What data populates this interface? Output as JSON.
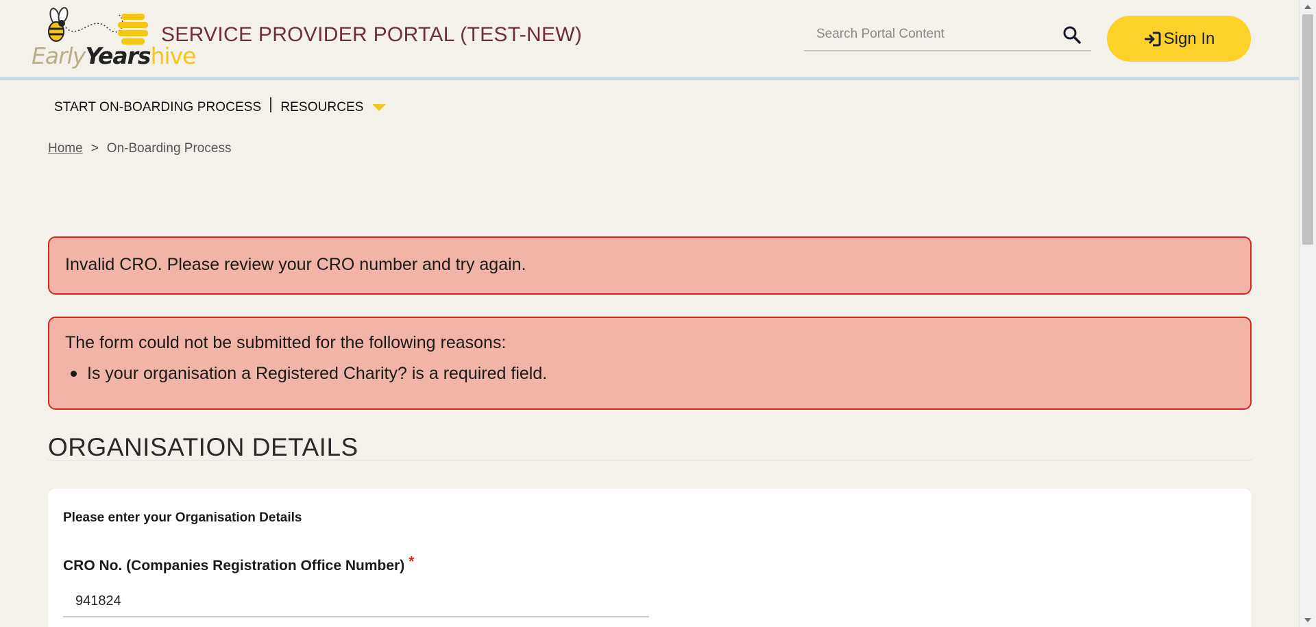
{
  "header": {
    "logo": {
      "early": "Early",
      "years": "Years",
      "hive": "hive"
    },
    "portal_title": "SERVICE PROVIDER PORTAL (TEST-NEW)",
    "search_placeholder": "Search Portal Content",
    "signin_label": "Sign In"
  },
  "nav": {
    "items": [
      {
        "label": "START ON-BOARDING PROCESS"
      },
      {
        "label": "RESOURCES"
      }
    ]
  },
  "breadcrumb": {
    "home": "Home",
    "separator": ">",
    "current": "On-Boarding Process"
  },
  "alerts": {
    "cro_error": "Invalid CRO. Please review your CRO number and try again.",
    "form_error_heading": "The form could not be submitted for the following reasons:",
    "form_error_items": [
      "Is your organisation a Registered Charity? is a required field."
    ]
  },
  "section": {
    "title": "ORGANISATION DETAILS",
    "intro": "Please enter your Organisation Details",
    "cro_label": "CRO No. (Companies Registration Office Number)",
    "required_marker": "*",
    "cro_value": "941824"
  },
  "colors": {
    "brand_yellow": "#fcd12a",
    "title_maroon": "#6e2f3a",
    "alert_bg": "#f2b3a8",
    "alert_border": "#d9241b",
    "page_bg": "#f4f1ea"
  },
  "icons": {
    "search": "search-icon",
    "signin": "sign-in-icon",
    "bee": "bee-logo-icon",
    "dropdown": "caret-down-icon"
  }
}
